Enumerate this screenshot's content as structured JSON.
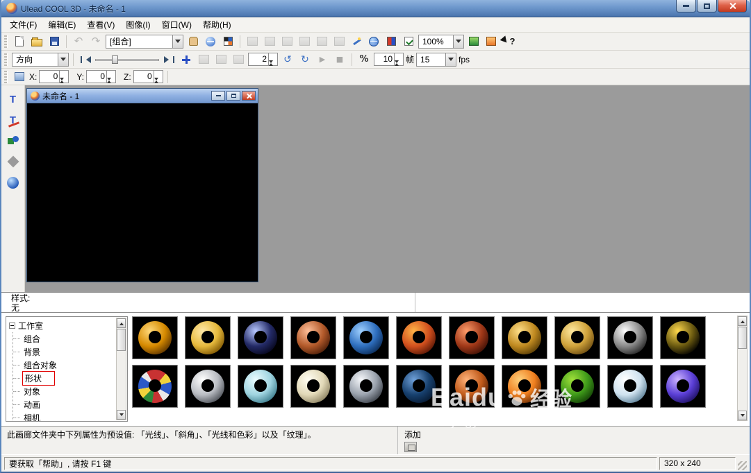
{
  "window": {
    "title": "Ulead COOL 3D - 未命名 - 1"
  },
  "menubar": {
    "items": [
      "文件(F)",
      "编辑(E)",
      "查看(V)",
      "图像(I)",
      "窗口(W)",
      "帮助(H)"
    ]
  },
  "toolbar_main": {
    "object_selector": "[组合]",
    "zoom_value": "100%"
  },
  "toolbar_anim": {
    "direction_label": "方向",
    "quality_value": "2",
    "frame_value": "10",
    "frame_unit": "帧",
    "fps_value": "15",
    "fps_unit": "fps"
  },
  "toolbar_pos": {
    "x_label": "X:",
    "x_value": "0",
    "y_label": "Y:",
    "y_value": "0",
    "z_label": "Z:",
    "z_value": "0"
  },
  "glyphs": {
    "undo": "↶",
    "redo": "↷",
    "rotate_ccw": "↺",
    "rotate_cw": "↻",
    "play": "▶",
    "stop": "■",
    "percent": "%",
    "help_mark": "?",
    "text_tool": "T"
  },
  "child_window": {
    "title": "未命名 - 1"
  },
  "style_panel": {
    "label": "样式:",
    "value": "无"
  },
  "tree_panel": {
    "root": "工作室",
    "items": [
      {
        "label": "组合",
        "highlight": false
      },
      {
        "label": "背景",
        "highlight": false
      },
      {
        "label": "组合对象",
        "highlight": false
      },
      {
        "label": "形状",
        "highlight": true
      },
      {
        "label": "对象",
        "highlight": false
      },
      {
        "label": "动画",
        "highlight": false
      },
      {
        "label": "相机",
        "highlight": false
      }
    ]
  },
  "gallery": {
    "rows": [
      [
        {
          "name": "amber-torus",
          "colors": [
            "#ffd97a",
            "#d68a00",
            "#5a3200"
          ]
        },
        {
          "name": "gold-torus",
          "colors": [
            "#ffe9a8",
            "#e6b93c",
            "#7a5200"
          ]
        },
        {
          "name": "navy-glossy-torus",
          "colors": [
            "#b8c8ff",
            "#232a66",
            "#05051a"
          ]
        },
        {
          "name": "copper-torus",
          "colors": [
            "#ffc09a",
            "#b35a2a",
            "#4a1d08"
          ]
        },
        {
          "name": "blue-rough-torus",
          "colors": [
            "#9fd0ff",
            "#2f6fbf",
            "#0a2a55"
          ]
        },
        {
          "name": "orange-rough-torus",
          "colors": [
            "#ffb347",
            "#d2501e",
            "#551505"
          ]
        },
        {
          "name": "russet-pattern-torus",
          "colors": [
            "#ff9d6b",
            "#a03818",
            "#3c0f05"
          ]
        },
        {
          "name": "gold-weave-torus",
          "colors": [
            "#ffe08a",
            "#c08a20",
            "#553a05"
          ]
        },
        {
          "name": "gold-nugget-torus",
          "colors": [
            "#ffe9a0",
            "#cfa23a",
            "#6a4a10"
          ]
        },
        {
          "name": "stone-patch-torus",
          "colors": [
            "#ffffff",
            "#8a8a8a",
            "#222222"
          ]
        },
        {
          "name": "leopard-torus",
          "colors": [
            "#ffd94d",
            "#6b5a10",
            "#000000"
          ]
        }
      ],
      [
        {
          "name": "patchwork-torus",
          "multi": true,
          "segments": [
            "#c83232 0deg 40deg",
            "#f0d23c 40deg 75deg",
            "#2b59c8 75deg 120deg",
            "#e8e8e8 120deg 150deg",
            "#c83232 150deg 190deg",
            "#2b8a3a 190deg 225deg",
            "#f0d23c 225deg 260deg",
            "#2b59c8 260deg 305deg",
            "#e8e8e8 305deg 330deg",
            "#c83232 330deg 360deg"
          ]
        },
        {
          "name": "silver-torus",
          "colors": [
            "#ffffff",
            "#b9bcc2",
            "#4a4e55"
          ]
        },
        {
          "name": "aqua-glossy-torus",
          "colors": [
            "#eafcff",
            "#9fd4e0",
            "#3a7a8a"
          ]
        },
        {
          "name": "ivory-torus",
          "colors": [
            "#fffdf2",
            "#e2d9b8",
            "#8a8060"
          ]
        },
        {
          "name": "chrome-torus",
          "colors": [
            "#f5f7fa",
            "#9aa2ad",
            "#3a3f47"
          ]
        },
        {
          "name": "darkblue-rough-torus",
          "colors": [
            "#6fa0d8",
            "#17406e",
            "#061830"
          ]
        },
        {
          "name": "copper-rough-torus",
          "colors": [
            "#ffb27a",
            "#c05a1a",
            "#4a1c05"
          ]
        },
        {
          "name": "orange-glossy-torus",
          "colors": [
            "#ffcf7a",
            "#ef7f1f",
            "#6a2c05"
          ]
        },
        {
          "name": "green-lathe-torus",
          "colors": [
            "#9fe03a",
            "#3f9a1a",
            "#123f05"
          ]
        },
        {
          "name": "white-blue-torus",
          "colors": [
            "#ffffff",
            "#cfe2ef",
            "#5a7e95"
          ]
        },
        {
          "name": "violet-torus",
          "colors": [
            "#cdb4ff",
            "#5b3fd6",
            "#1d1060"
          ]
        }
      ]
    ]
  },
  "info_bar": {
    "text": "此画廊文件夹中下列属性为预设值: 「光线」、「斜角」、「光线和色彩」以及「纹理」。",
    "add_label": "添加"
  },
  "status_bar": {
    "help_text": "要获取「帮助」, 请按 F1 键",
    "size_value": "320 x 240"
  },
  "watermark": {
    "brand": "Baidu",
    "suffix": "经验",
    "url": "jingyan.baidu.com"
  }
}
